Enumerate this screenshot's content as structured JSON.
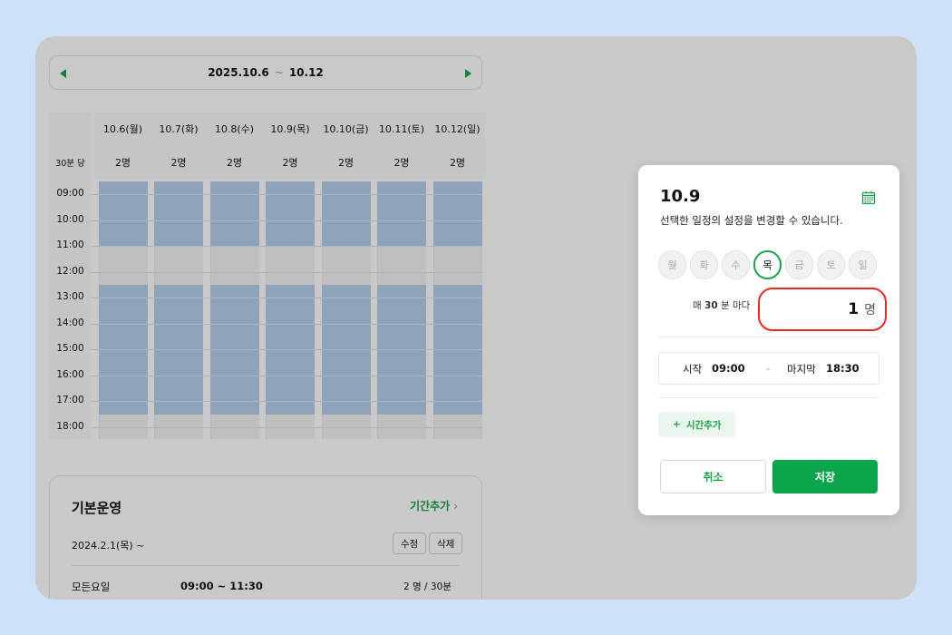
{
  "week_nav": {
    "start": "2025.10.6",
    "separator": "~",
    "end": "10.12"
  },
  "grid": {
    "capacity_row_label": "30분 당",
    "days": [
      {
        "label": "10.6(월)",
        "capacity": "2명"
      },
      {
        "label": "10.7(화)",
        "capacity": "2명"
      },
      {
        "label": "10.8(수)",
        "capacity": "2명"
      },
      {
        "label": "10.9(목)",
        "capacity": "2명"
      },
      {
        "label": "10.10(금)",
        "capacity": "2명"
      },
      {
        "label": "10.11(토)",
        "capacity": "2명"
      },
      {
        "label": "10.12(일)",
        "capacity": "2명"
      }
    ],
    "times": [
      "09:00",
      "10:00",
      "11:00",
      "12:00",
      "13:00",
      "14:00",
      "15:00",
      "16:00",
      "17:00",
      "18:00"
    ],
    "available_ranges": [
      {
        "start": "09:00",
        "end": "11:30"
      },
      {
        "start": "13:00",
        "end": "18:00"
      }
    ],
    "block_color": "#b6d0ec"
  },
  "base_operation": {
    "title": "기본운영",
    "add_period_label": "기간추가",
    "date": "2024.2.1(목) ~",
    "edit_label": "수정",
    "delete_label": "삭제",
    "row": {
      "days": "모든요일",
      "hours": "09:00 ~ 11:30",
      "capacity": "2 명 / 30분"
    }
  },
  "dialog": {
    "title": "10.9",
    "description": "선택한 일정의 설정을 변경할 수 있습니다.",
    "weekdays": [
      {
        "label": "월",
        "active": false
      },
      {
        "label": "화",
        "active": false
      },
      {
        "label": "수",
        "active": false
      },
      {
        "label": "목",
        "active": true
      },
      {
        "label": "금",
        "active": false
      },
      {
        "label": "토",
        "active": false
      },
      {
        "label": "일",
        "active": false
      }
    ],
    "every_prefix": "매",
    "every_value": "30",
    "every_suffix": "분 마다",
    "count_value": "1",
    "count_unit": "명",
    "start_label": "시작",
    "start_value": "09:00",
    "range_separator": "-",
    "end_label": "마지막",
    "end_value": "18:30",
    "add_time_label": "시간추가",
    "add_time_icon": "+",
    "cancel_label": "취소",
    "save_label": "저장"
  },
  "colors": {
    "accent": "#1aa34a",
    "highlight": "#e8291c",
    "save_button": "#0ca54c"
  }
}
